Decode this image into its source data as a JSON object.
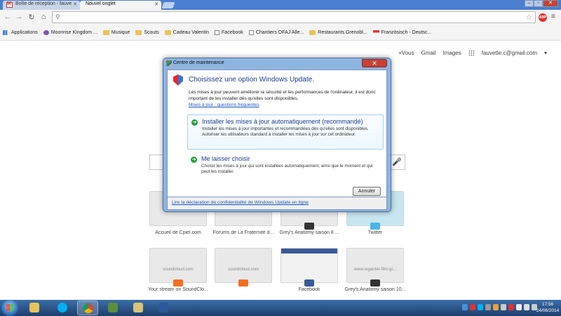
{
  "browser": {
    "tabs": [
      {
        "label": "Boîte de réception - fauve"
      },
      {
        "label": "Nouvel onglet"
      }
    ],
    "omnibox": {
      "value": ""
    },
    "bookmarks": [
      {
        "label": "Applications",
        "icon": "apps-grid-icon"
      },
      {
        "label": "Moonrise Kingdom ...",
        "icon": "moon-icon"
      },
      {
        "label": "Musique",
        "icon": "folder-icon"
      },
      {
        "label": "Scouts",
        "icon": "folder-icon"
      },
      {
        "label": "Cadeau Valentin",
        "icon": "folder-icon"
      },
      {
        "label": "Facebook",
        "icon": "page-icon"
      },
      {
        "label": "Chantiers OFAJ Alle...",
        "icon": "page-icon"
      },
      {
        "label": "Restaurants Grenobl...",
        "icon": "folder-icon"
      },
      {
        "label": "Französisch - Deutsc...",
        "icon": "flag-icon"
      }
    ]
  },
  "ntp": {
    "links": {
      "plus": "+Vous",
      "gmail": "Gmail",
      "images": "Images",
      "account": "fauvette.c@gmail.com"
    },
    "tiles": [
      {
        "tile_text": "",
        "caption": "Accueil de Cpiel.com"
      },
      {
        "tile_text": "",
        "caption": "Forums de La Fraternité d..."
      },
      {
        "tile_text": "",
        "caption": "Grey's Anatomy saison 8 ..."
      },
      {
        "tile_text": "",
        "caption": "Twitter"
      },
      {
        "tile_text": "soundcloud.com",
        "caption": "Your stream on SoundClo..."
      },
      {
        "tile_text": "soundcloud.com",
        "caption": ""
      },
      {
        "tile_text": "",
        "caption": "Facebook"
      },
      {
        "tile_text": "www.regarder-film-gr...",
        "caption": "Grey's Anatomy saison 10..."
      }
    ]
  },
  "dialog": {
    "window_title": "Centre de maintenance",
    "close_label": "✕",
    "heading": "Choisissez une option Windows Update.",
    "description": "Les mises à jour peuvent améliorer la sécurité et les performances de l'ordinateur, il est donc important de les installer dès qu'elles sont disponibles.",
    "faq_link": "Mises à jour : questions fréquentes",
    "option1": {
      "title": "Installer les mises à jour automatiquement (recommandé)",
      "desc": "Installer les mises à jour importantes et recommandées dès qu'elles sont disponibles. Autoriser les utilisateurs standard à installer les mises à jour sur cet ordinateur."
    },
    "option2": {
      "title": "Me laisser choisir",
      "desc": "Choisir les mises à jour qui sont installées automatiquement, ainsi que le moment et qui peut les installer."
    },
    "cancel_label": "Annuler",
    "privacy_link": "Lire la déclaration de confidentialité de Windows Update en ligne"
  },
  "taskbar": {
    "time": "17:56",
    "date": "24/06/2014"
  }
}
